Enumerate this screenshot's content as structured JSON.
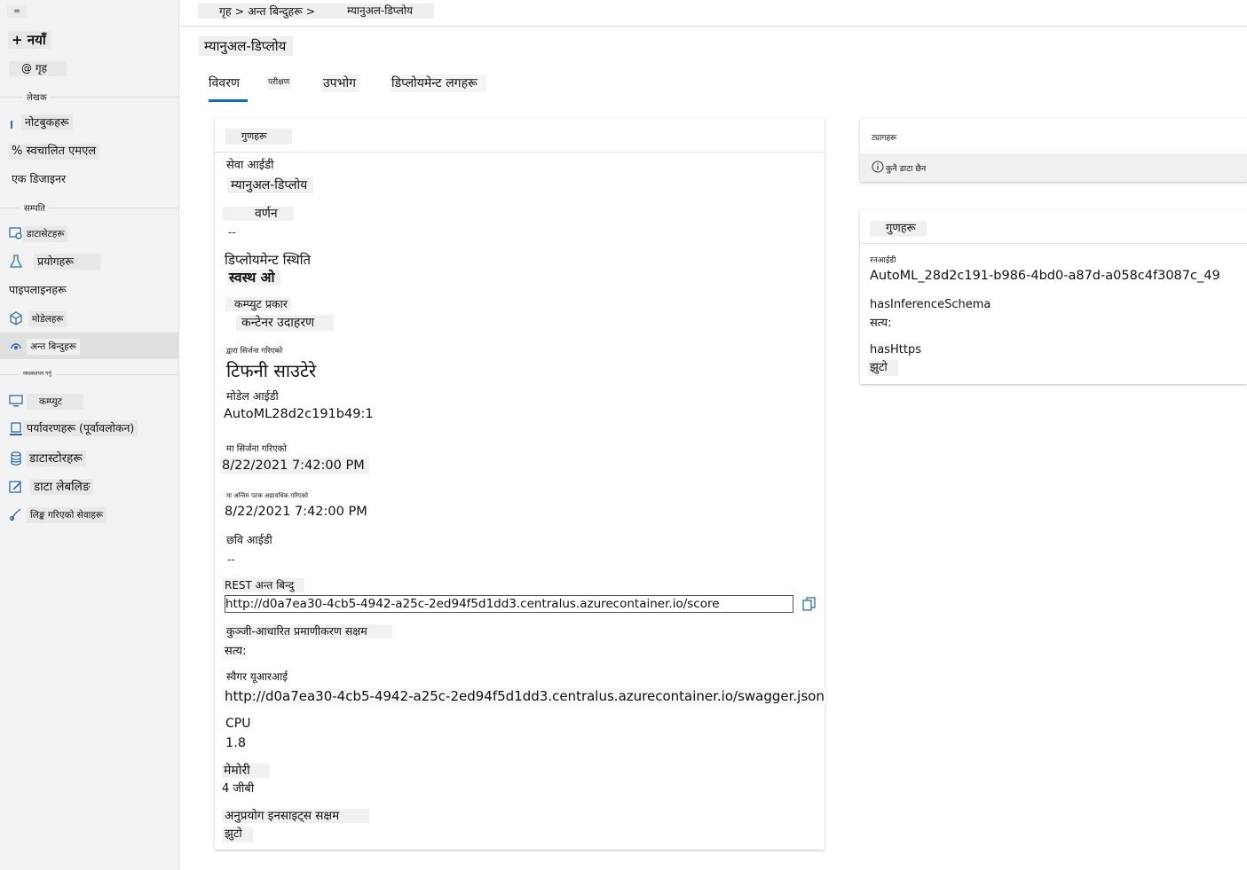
{
  "sidebar": {
    "menu_glyph": "=",
    "new_label": "+ नयाँ",
    "home_label": "@ गृह",
    "section_author": "लेखक",
    "section_assets": "सम्पति",
    "section_manage": "व्यवस्थापन गर्नु",
    "items": [
      {
        "label": "नोटबुकहरू",
        "icon": "notebook-icon"
      },
      {
        "label": "% स्वचालित एमएल",
        "icon": "automl-icon"
      },
      {
        "label": "एक डिजाइनर",
        "icon": "designer-icon"
      },
      {
        "label": "डाटासेटहरू",
        "icon": "datasets-icon"
      },
      {
        "label": "प्रयोगहरू",
        "icon": "experiments-icon"
      },
      {
        "label": "पाइपलाइनहरू",
        "icon": "pipelines-icon"
      },
      {
        "label": "मोडेलहरू",
        "icon": "models-icon"
      },
      {
        "label": "अन्त बिन्दुहरू",
        "icon": "endpoints-icon"
      },
      {
        "label": "कम्प्युट",
        "icon": "compute-icon"
      },
      {
        "label": "पर्यावरणहरू (पूर्वावलोकन)",
        "icon": "environments-icon"
      },
      {
        "label": "डाटास्टोरहरू",
        "icon": "datastores-icon"
      },
      {
        "label": "डाटा लेबलिङ",
        "icon": "data-labeling-icon"
      },
      {
        "label": "लिङ्क गरिएको सेवाहरू",
        "icon": "linked-services-icon"
      }
    ]
  },
  "breadcrumb": {
    "path": "गृह > अन्त बिन्दुहरू >",
    "current": "म्यानुअल-डिप्लोय"
  },
  "page_title": "म्यानुअल-डिप्लोय",
  "tabs": [
    "विवरण",
    "परीक्षण",
    "उपभोग",
    "डिप्लोयमेन्ट लगहरू"
  ],
  "attributes_card": {
    "title": "गुणहरू",
    "service_id_label": "सेवा आईडी",
    "service_id_value": "म्यानुअल-डिप्लोय",
    "description_label": "वर्णन",
    "description_value": "--",
    "deploy_state_label": "डिप्लोयमेन्ट स्थिति",
    "deploy_state_value": "स्वस्थ ओ",
    "compute_type_label": "कम्प्युट प्रकार",
    "compute_type_value": "कन्टेनर उदाहरण",
    "created_by_label": "द्वारा सिर्जना गरिएको",
    "created_by_value": "टिफनी साउटेरे",
    "model_id_label": "मोडेल आईडी",
    "model_id_value": "AutoML28d2c191b49:1",
    "created_on_label": "मा सिर्जना गरिएको",
    "created_on_value": "8/22/2021 7:42:00 PM",
    "updated_on_label": "मा अन्तिम पटक अद्यावधिक गरिएको",
    "updated_on_value": "8/22/2021 7:42:00 PM",
    "image_id_label": "छवि आईडी",
    "image_id_value": "--",
    "rest_label": "REST अन्त बिन्दु",
    "rest_value": "http://d0a7ea30-4cb5-4942-a25c-2ed94f5d1dd3.centralus.azurecontainer.io/score",
    "key_auth_label": "कुञ्जी-आधारित प्रमाणीकरण सक्षम",
    "key_auth_value": "सत्य:",
    "swagger_label": "स्वैगर यूआरआई",
    "swagger_value": "http://d0a7ea30-4cb5-4942-a25c-2ed94f5d1dd3.centralus.azurecontainer.io/swagger.json",
    "cpu_label": "CPU",
    "cpu_value": "1.8",
    "memory_label": "मेमोरी",
    "memory_value": "4 जीबी",
    "app_insights_label": "अनुप्रयोग इनसाइट्स सक्षम",
    "app_insights_value": "झुटो"
  },
  "tags_card": {
    "title": "ट्यागहरू",
    "empty_text": "कुनै डाटा छैन"
  },
  "properties_card": {
    "title": "गुणहरू",
    "run_id_label": "रनआईडी",
    "run_id_value": "AutoML_28d2c191-b986-4bd0-a87d-a058c4f3087c_49",
    "schema_label": "hasInferenceSchema",
    "schema_value": "सत्य:",
    "https_label": "hasHttps",
    "https_value": "झुटो"
  },
  "colors": {
    "accent": "#0f6cbd",
    "sidebar_bg": "#f3f3f3",
    "icon_blue": "#2b6cb0"
  }
}
